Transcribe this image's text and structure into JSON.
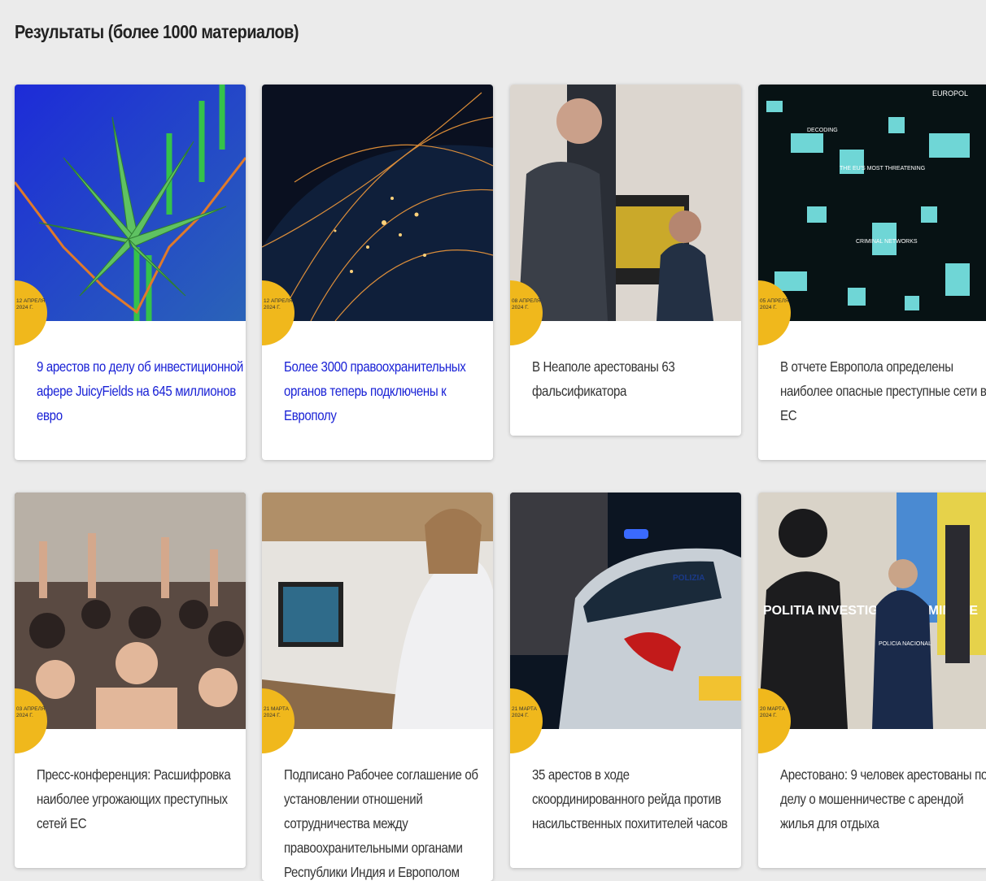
{
  "results": {
    "title": "Результаты (более 1000 материалов)"
  },
  "articles": [
    {
      "date": "12 апреля 2024 г.",
      "title": "9 арестов по делу об инвестиционной афере JuicyFields на 645 миллионов евро",
      "image": "cannabis-chart-image",
      "link_color": "#1a22d6"
    },
    {
      "date": "12 апреля 2024 г.",
      "title": "Более 3000 правоохранительных органов теперь подключены к Европолу",
      "image": "earth-network-image",
      "link_color": "#1a22d6"
    },
    {
      "date": "08 апреля 2024 г.",
      "title": "В Неаполе арестованы 63 фальсификатора",
      "image": "europol-officer-computer-image"
    },
    {
      "date": "05 апреля 2024 г.",
      "title": "В отчете Европола определены наиболее опасные преступные сети в ЕС",
      "image": "criminal-networks-map-image",
      "image_text": {
        "brand": "EUROPOL",
        "decoding": "DECODING",
        "threatening": "THE EU'S MOST THREATENING",
        "networks": "CRIMINAL NETWORKS"
      }
    },
    {
      "date": "03 апреля 2024 г.",
      "title": "Пресс-конференция: Расшифровка наиболее угрожающих преступных сетей ЕС",
      "image": "audience-hands-raised-image"
    },
    {
      "date": "21 марта 2024 г.",
      "title": "Подписано Рабочее соглашение об установлении отношений сотрудничества между правоохранительными органами Республики Индия и Европолом",
      "image": "signing-meeting-image"
    },
    {
      "date": "21 марта 2024 г.",
      "title": "35 арестов в ходе скоординированного рейда против насильственных похитителей часов",
      "image": "polizia-car-night-image",
      "image_text": {
        "car": "POLIZIA"
      }
    },
    {
      "date": "20 марта 2024 г.",
      "title": "Арестовано: 9 человек арестованы по делу о мошенничестве с арендой жилья для отдыха",
      "image": "politia-raid-image",
      "image_text": {
        "vest": "POLITIA INVESTIGATII CRIMINALE",
        "badge": "POLICIA NACIONAL"
      }
    }
  ]
}
